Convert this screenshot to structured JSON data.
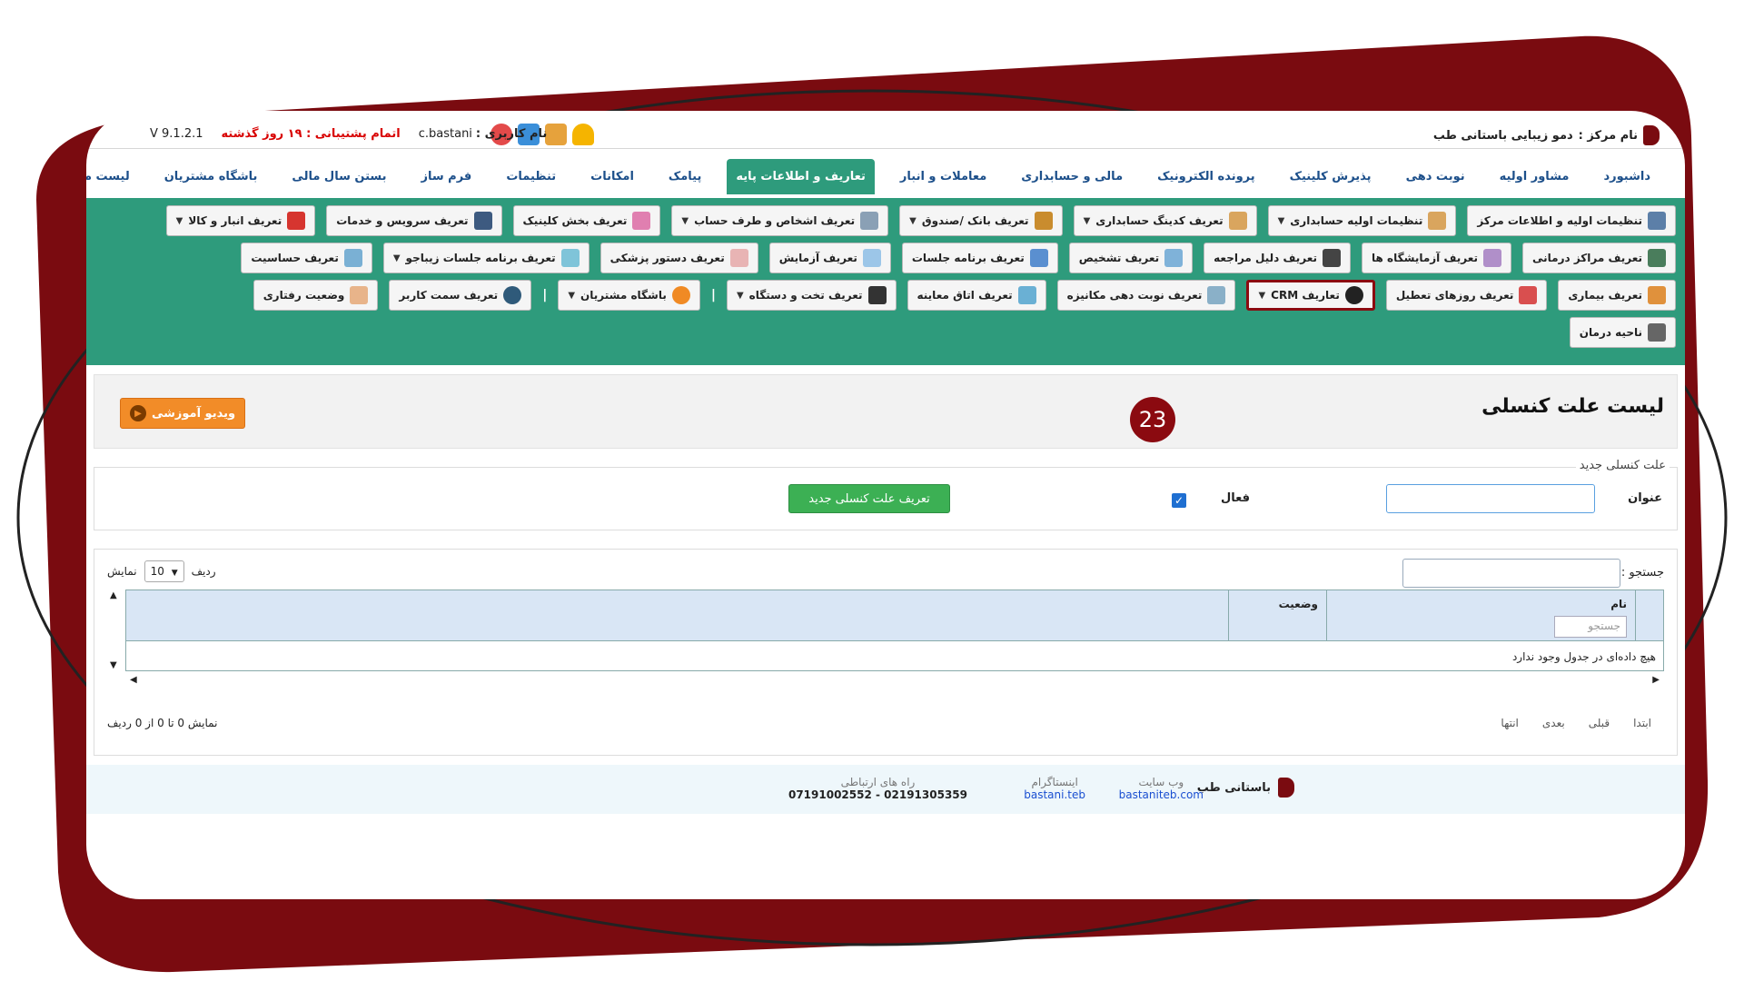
{
  "header": {
    "center_label": "نام مرکز :",
    "center_name": "دمو زیبایی باستانی طب",
    "username_label": "نام کاربری :",
    "username": "c.bastani",
    "support": "اتمام پشتیبانی : ۱۹ روز گذشته",
    "version": "V 9.1.2.1"
  },
  "nav": [
    "داشبورد",
    "مشاور اولیه",
    "نوبت دهی",
    "پذیرش کلینیک",
    "پرونده الکترونیک",
    "مالی و حسابداری",
    "معاملات و انبار",
    "تعاریف و اطلاعات پایه",
    "پیامک",
    "امکانات",
    "تنظیمات",
    "فرم ساز",
    "بستن سال مالی",
    "باشگاه مشتریان",
    "لیست ماژول ها"
  ],
  "nav_active_index": 7,
  "toolbar": {
    "row1": [
      "تنظیمات اولیه و اطلاعات مرکز",
      "تنظیمات اولیه حسابداری",
      "تعریف کدینگ حسابداری",
      "تعریف بانک /صندوق",
      "تعریف اشخاص و طرف حساب",
      "تعریف بخش کلینیک",
      "تعریف سرویس و خدمات",
      "تعریف انبار و کالا"
    ],
    "row2": [
      "تعریف مراکز درمانی",
      "تعریف آزمایشگاه ها",
      "تعریف دلیل مراجعه",
      "تعریف تشخیص",
      "تعریف برنامه جلسات",
      "تعریف آزمایش",
      "تعریف دستور پزشکی",
      "تعریف برنامه جلسات زیباجو",
      "تعریف حساسیت"
    ],
    "row3": [
      "تعریف بیماری",
      "تعریف روزهای تعطیل",
      "تعاریف CRM",
      "تعریف نوبت دهی مکانیزه",
      "تعریف اتاق معاینه",
      "تعریف تخت و دستگاه",
      "باشگاه مشتریان",
      "تعریف سمت کاربر",
      "وضعیت رفتاری"
    ],
    "row4": [
      "ناحیه درمان"
    ]
  },
  "page": {
    "title": "لیست علت کنسلی",
    "step_badge": "23",
    "video_button": "ویدیو آموزشی"
  },
  "form": {
    "legend": "علت کنسلی جدید",
    "title_label": "عنوان",
    "active_label": "فعال",
    "active_checked": true,
    "submit": "تعریف علت کنسلی جدید"
  },
  "table": {
    "search_label": "جستجو :",
    "show_label": "نمایش",
    "page_size": "10",
    "rows_label": "ردیف",
    "columns": [
      "نام",
      "وضعیت"
    ],
    "column_search_placeholder": "جستجو",
    "empty_text": "هیچ داده‌ای در جدول وجود ندارد",
    "pager": [
      "ابتدا",
      "قبلی",
      "بعدی",
      "انتها"
    ],
    "info": "نمایش 0 تا 0 از 0 ردیف"
  },
  "footer": {
    "brand": "باستانی طب",
    "website_label": "وب سایت",
    "website": "bastaniteb.com",
    "instagram_label": "اینستاگرام",
    "instagram": "bastani.teb",
    "contact_label": "راه های ارتباطی",
    "contact": "07191002552 - 02191305359"
  },
  "colors": {
    "brand": "#8b0a10",
    "toolbar": "#2e9b7c",
    "accent_orange": "#f28c28",
    "success": "#3cb054"
  }
}
